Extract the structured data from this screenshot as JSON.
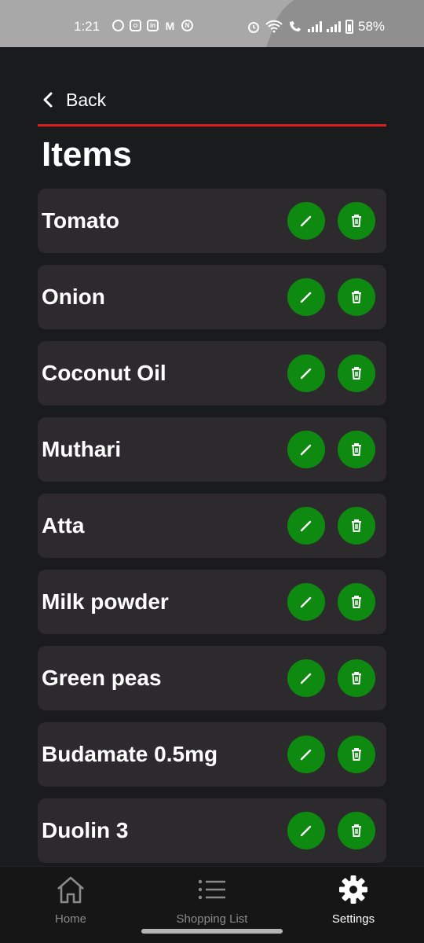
{
  "status_bar": {
    "time": "1:21",
    "battery": "58%",
    "app_icons": [
      "chat-icon",
      "instagram-icon",
      "linkedin-icon",
      "gmail-icon",
      "app-icon"
    ]
  },
  "header": {
    "back_label": "Back",
    "title": "Items",
    "accent_color": "#d81e1e"
  },
  "items": [
    {
      "name": "Tomato"
    },
    {
      "name": "Onion"
    },
    {
      "name": "Coconut Oil"
    },
    {
      "name": "Muthari"
    },
    {
      "name": "Atta"
    },
    {
      "name": "Milk powder"
    },
    {
      "name": "Green peas"
    },
    {
      "name": "Budamate 0.5mg"
    },
    {
      "name": "Duolin 3"
    }
  ],
  "button_color": "#0f8a10",
  "nav": {
    "home": "Home",
    "shopping_list": "Shopping List",
    "settings": "Settings",
    "active": "Settings"
  }
}
